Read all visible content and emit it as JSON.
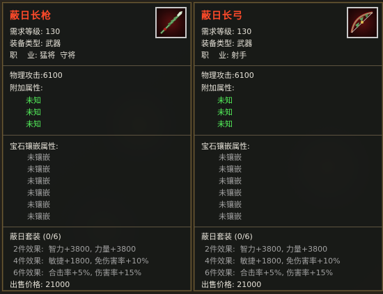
{
  "panels": [
    {
      "title": "蔽日长枪",
      "icon": "spear-icon",
      "level_label": "需求等级:",
      "level_value": "130",
      "type_label": "装备类型:",
      "type_value": "武器",
      "job_label": "职    业:",
      "job_value": "猛将  守将",
      "attack_label": "物理攻击:",
      "attack_value": "6100",
      "extra_label": "附加属性:",
      "extra_values": [
        "未知",
        "未知",
        "未知"
      ],
      "gem_label": "宝石镶嵌属性:",
      "gem_slots": [
        "未镶嵌",
        "未镶嵌",
        "未镶嵌",
        "未镶嵌",
        "未镶嵌",
        "未镶嵌"
      ],
      "set_title": "蔽日套装 (0/6)",
      "set_effects": [
        {
          "label": "2件效果:",
          "effect": "智力+3800, 力量+3800"
        },
        {
          "label": "4件效果:",
          "effect": "敏捷+1800, 免伤害率+10%"
        },
        {
          "label": "6件效果:",
          "effect": "合击率+5%, 伤害率+15%"
        }
      ],
      "price_label": "出售价格:",
      "price_value": "21000"
    },
    {
      "title": "蔽日长弓",
      "icon": "bow-icon",
      "level_label": "需求等级:",
      "level_value": "130",
      "type_label": "装备类型:",
      "type_value": "武器",
      "job_label": "职    业:",
      "job_value": "射手",
      "attack_label": "物理攻击:",
      "attack_value": "6100",
      "extra_label": "附加属性:",
      "extra_values": [
        "未知",
        "未知",
        "未知"
      ],
      "gem_label": "宝石镶嵌属性:",
      "gem_slots": [
        "未镶嵌",
        "未镶嵌",
        "未镶嵌",
        "未镶嵌",
        "未镶嵌",
        "未镶嵌"
      ],
      "set_title": "蔽日套装 (0/6)",
      "set_effects": [
        {
          "label": "2件效果:",
          "effect": "智力+3800, 力量+3800"
        },
        {
          "label": "4件效果:",
          "effect": "敏捷+1800, 免伤害率+10%"
        },
        {
          "label": "6件效果:",
          "effect": "合击率+5%, 伤害率+15%"
        }
      ],
      "price_label": "出售价格:",
      "price_value": "21000"
    }
  ],
  "colors": {
    "title": "#ff4a2a",
    "unknown": "#53f05a",
    "muted": "#a0a0a0",
    "text": "#e6e2d8"
  }
}
